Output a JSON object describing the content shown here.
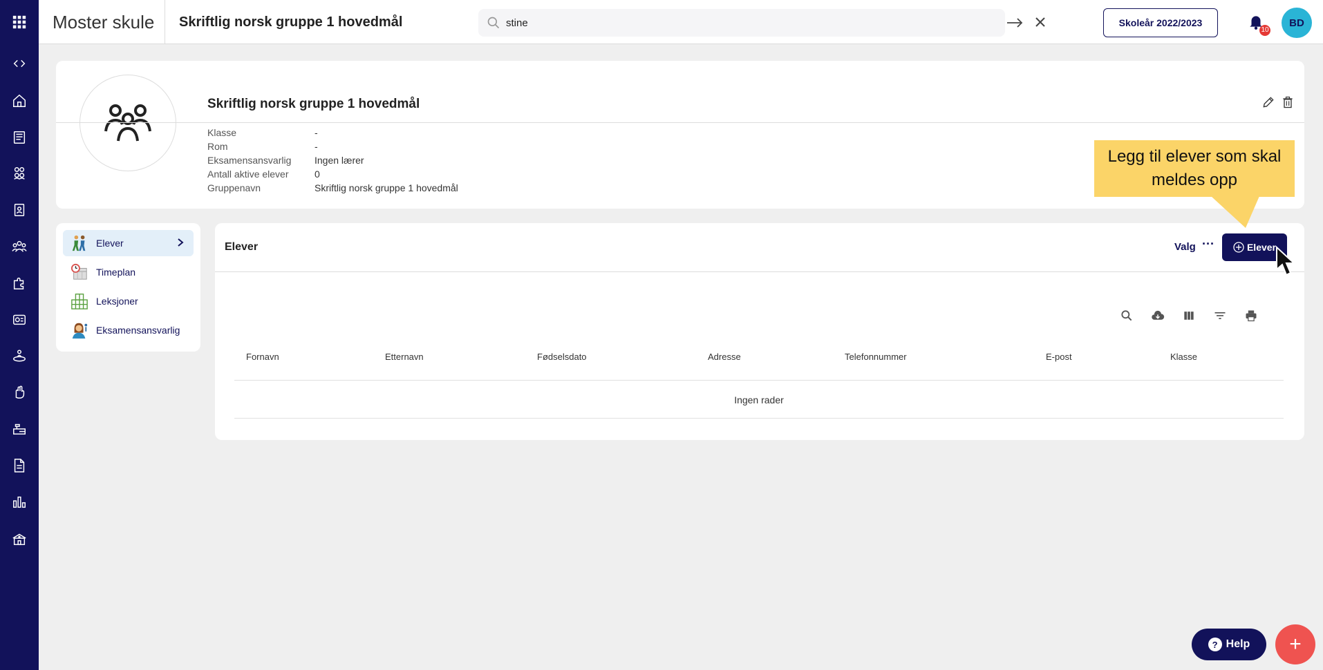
{
  "app": {
    "school_name": "Moster skule",
    "group_title": "Skriftlig norsk gruppe 1 hovedmål"
  },
  "search": {
    "value": "stine",
    "placeholder": ""
  },
  "topbar": {
    "school_year_label": "Skoleår 2022/2023",
    "notification_count": "10",
    "avatar_initials": "BD"
  },
  "rail": {
    "icons": [
      "apps-grid-icon",
      "collapse-toggle-icon",
      "home-icon",
      "news-icon",
      "groups-icon",
      "student-card-icon",
      "people-icon",
      "puzzle-icon",
      "exam-icon",
      "person-rotate-icon",
      "hand-icon",
      "desk-icon",
      "document-icon",
      "bar-chart-icon",
      "school-building-icon"
    ]
  },
  "group": {
    "name": "Skriftlig norsk gruppe 1 hovedmål",
    "fields": [
      {
        "label": "Klasse",
        "value": "-"
      },
      {
        "label": "Rom",
        "value": "-"
      },
      {
        "label": "Eksamensansvarlig",
        "value": "Ingen lærer"
      },
      {
        "label": "Antall aktive elever",
        "value": "0"
      },
      {
        "label": "Gruppenavn",
        "value": "Skriftlig norsk gruppe 1 hovedmål"
      }
    ]
  },
  "callout": {
    "text": "Legg til elever som skal meldes opp"
  },
  "sidenav": {
    "items": [
      {
        "label": "Elever",
        "icon": "students-walking-icon"
      },
      {
        "label": "Timeplan",
        "icon": "schedule-icon"
      },
      {
        "label": "Leksjoner",
        "icon": "lessons-grid-icon"
      },
      {
        "label": "Eksamensansvarlig",
        "icon": "exam-teacher-icon"
      }
    ]
  },
  "panel": {
    "title": "Elever",
    "valg_label": "Valg",
    "more_label": "···",
    "add_button_label": "Elever",
    "columns": [
      "Fornavn",
      "Etternavn",
      "Fødselsdato",
      "Adresse",
      "Telefonnummer",
      "E-post",
      "Klasse"
    ],
    "empty_text": "Ingen rader"
  },
  "help": {
    "label": "Help",
    "q": "?"
  },
  "fab": {
    "label": "+"
  },
  "colors": {
    "navy": "#12125a",
    "accent_cyan": "#2ab4d6",
    "callout_yellow": "#fbd468",
    "fab_red": "#ef5350"
  }
}
